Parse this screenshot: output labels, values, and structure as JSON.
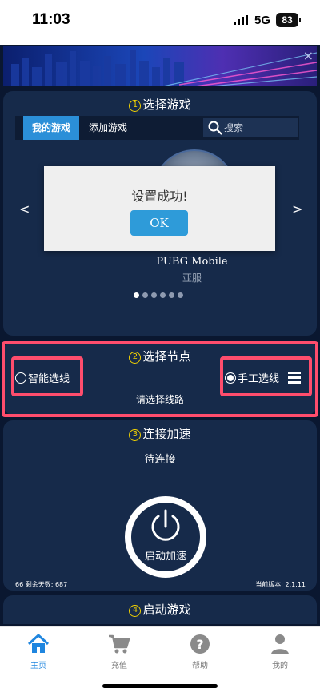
{
  "status_bar": {
    "time": "11:03",
    "network": "5G",
    "battery": "83"
  },
  "banner": {
    "close_icon": "×"
  },
  "select_game": {
    "number": "1",
    "title": "选择游戏",
    "tabs": [
      "我的游戏",
      "添加游戏"
    ],
    "search_placeholder": "搜索",
    "prev_arrow": "<",
    "next_arrow": ">",
    "game_name": "PUBG Mobile",
    "game_region": "亚服",
    "page_count": 6,
    "active_page": 1
  },
  "select_node": {
    "number": "2",
    "title": "选择节点",
    "smart_label": "智能选线",
    "manual_label": "手工选线",
    "smart_selected": false,
    "manual_selected": true,
    "hint": "请选择线路"
  },
  "connect": {
    "number": "3",
    "title": "连接加速",
    "status": "待连接",
    "start_label": "启动加速",
    "days_left": "66 剩余天数: 687",
    "version": "当前版本: 2.1.11"
  },
  "launch_game": {
    "number": "4",
    "title": "启动游戏"
  },
  "tab_bar": {
    "items": [
      {
        "label": "主页",
        "icon": "home-icon",
        "active": true
      },
      {
        "label": "充值",
        "icon": "cart-icon",
        "active": false
      },
      {
        "label": "帮助",
        "icon": "help-icon",
        "active": false
      },
      {
        "label": "我的",
        "icon": "user-icon",
        "active": false
      }
    ]
  },
  "dialog": {
    "message": "设置成功!",
    "ok_label": "OK"
  },
  "colors": {
    "accent": "#2b8fd8",
    "highlight": "#ff4d6d",
    "number_badge": "#f2d200",
    "background": "#0a1730",
    "card": "#162a4a"
  }
}
